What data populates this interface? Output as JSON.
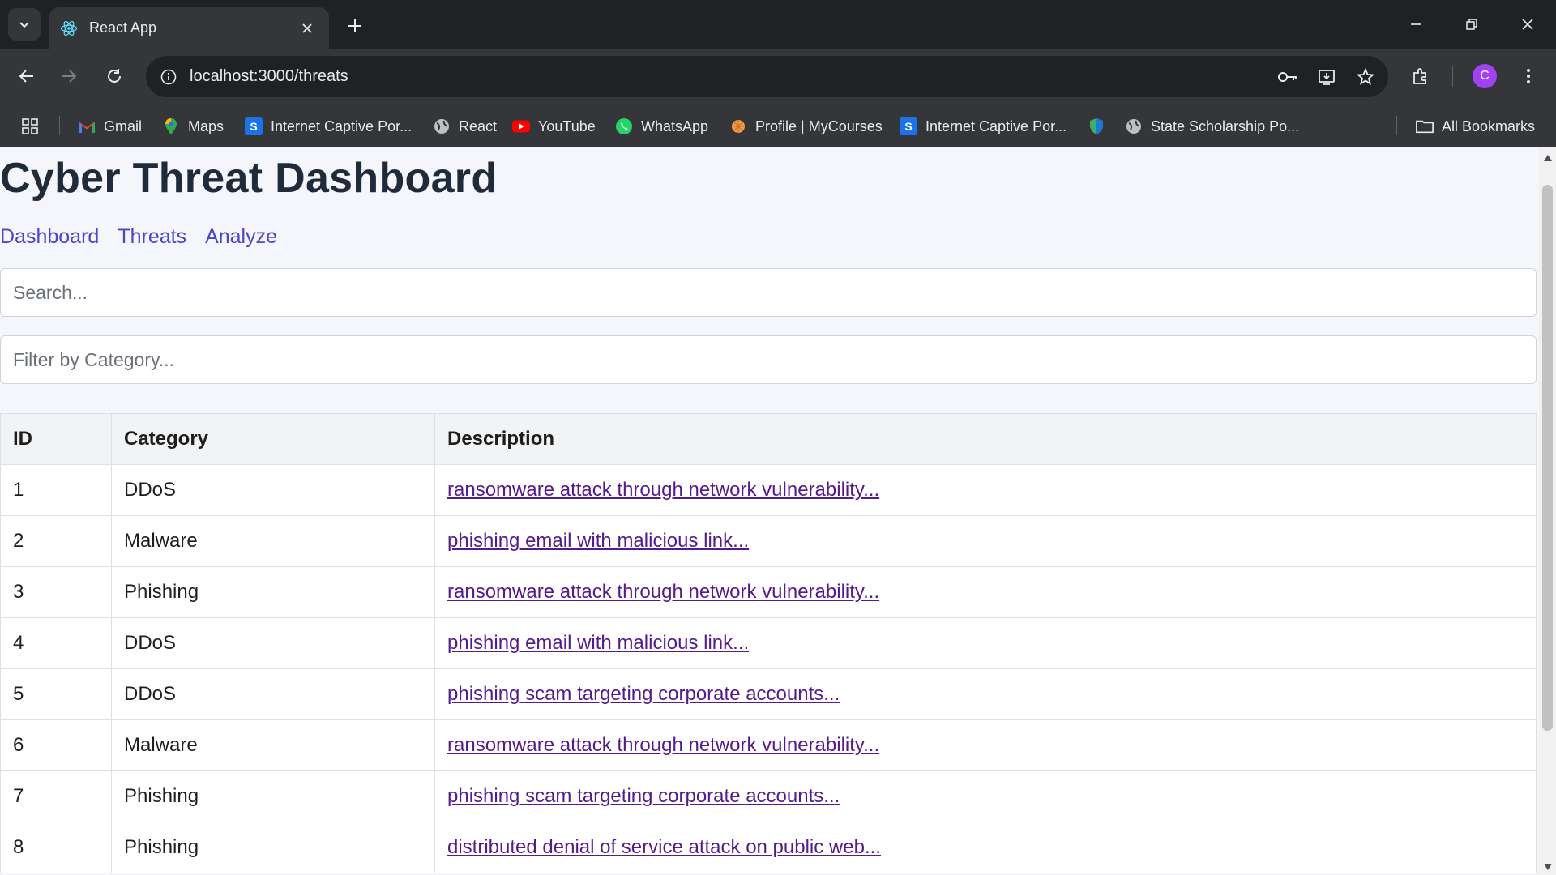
{
  "browser": {
    "tab_title": "React App",
    "url": "localhost:3000/threats",
    "avatar_letter": "C",
    "bookmarks": [
      {
        "label": "Gmail",
        "icon": "gmail-icon"
      },
      {
        "label": "Maps",
        "icon": "maps-icon"
      },
      {
        "label": "Internet Captive Por...",
        "icon": "s-icon"
      },
      {
        "label": "React",
        "icon": "globe-icon"
      },
      {
        "label": "YouTube",
        "icon": "youtube-icon"
      },
      {
        "label": "WhatsApp",
        "icon": "whatsapp-icon"
      },
      {
        "label": "Profile | MyCourses",
        "icon": "mycourses-icon"
      },
      {
        "label": "Internet Captive Por...",
        "icon": "s-icon"
      },
      {
        "label": "",
        "icon": "shield-icon"
      },
      {
        "label": "State Scholarship Po...",
        "icon": "globe-icon"
      }
    ],
    "all_bookmarks": "All Bookmarks"
  },
  "page": {
    "title": "Cyber Threat Dashboard",
    "nav": [
      "Dashboard",
      "Threats",
      "Analyze"
    ],
    "search_placeholder": "Search...",
    "filter_placeholder": "Filter by Category...",
    "table": {
      "headers": [
        "ID",
        "Category",
        "Description"
      ],
      "rows": [
        {
          "id": "1",
          "category": "DDoS",
          "description": "ransomware attack through network vulnerability..."
        },
        {
          "id": "2",
          "category": "Malware",
          "description": "phishing email with malicious link..."
        },
        {
          "id": "3",
          "category": "Phishing",
          "description": "ransomware attack through network vulnerability..."
        },
        {
          "id": "4",
          "category": "DDoS",
          "description": "phishing email with malicious link..."
        },
        {
          "id": "5",
          "category": "DDoS",
          "description": "phishing scam targeting corporate accounts..."
        },
        {
          "id": "6",
          "category": "Malware",
          "description": "ransomware attack through network vulnerability..."
        },
        {
          "id": "7",
          "category": "Phishing",
          "description": "phishing scam targeting corporate accounts..."
        },
        {
          "id": "8",
          "category": "Phishing",
          "description": "distributed denial of service attack on public web..."
        }
      ]
    }
  },
  "colors": {
    "link_visited": "#551a8b",
    "nav_link": "#4b45c8",
    "title": "#1f2a3a",
    "page_bg": "#f4f6fb"
  }
}
